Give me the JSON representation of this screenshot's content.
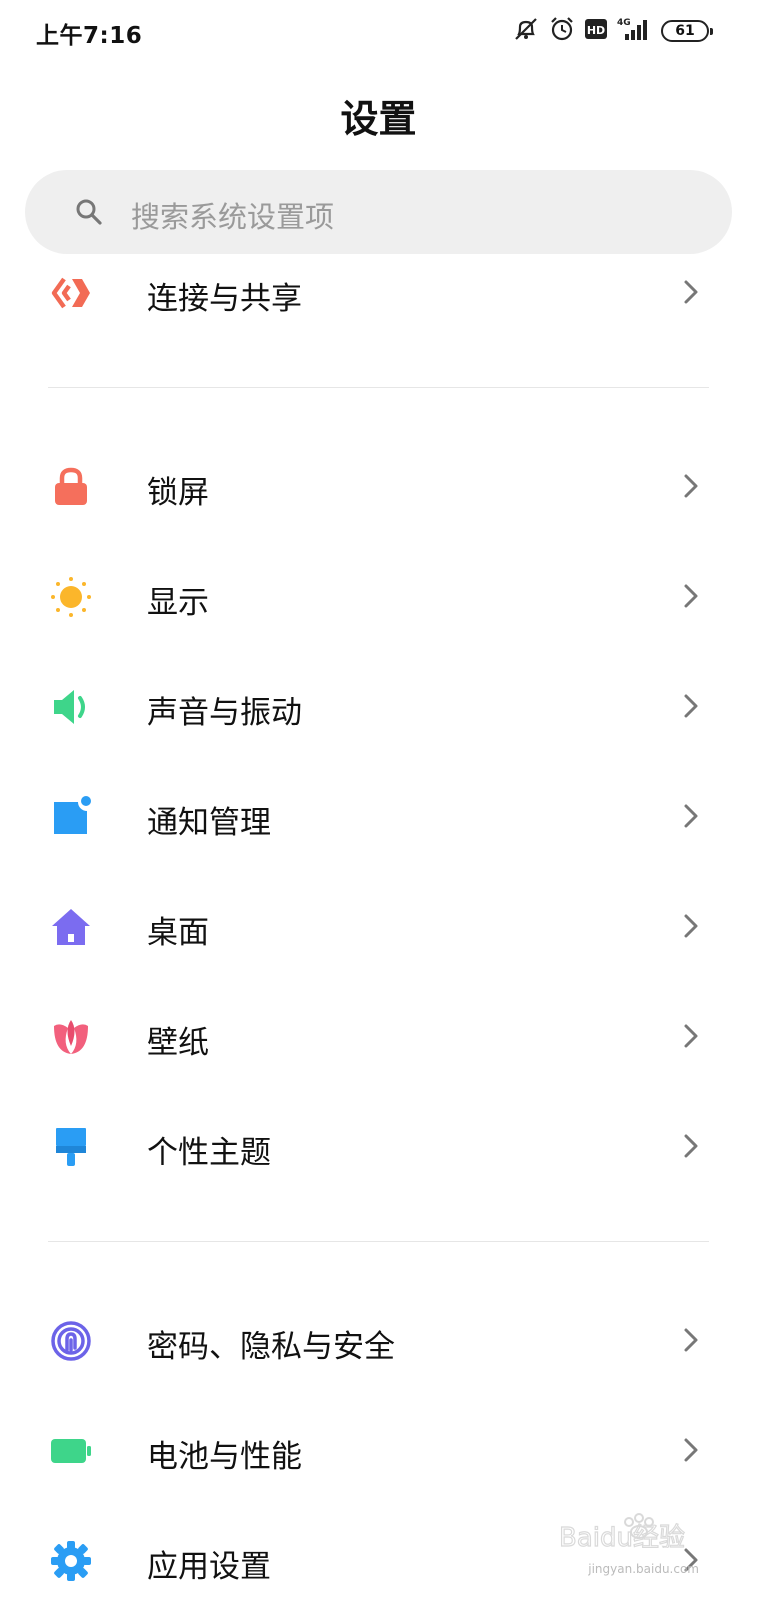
{
  "status_bar": {
    "time": "上午7:16",
    "signal_label": "4G",
    "hd_label": "HD",
    "battery": "61"
  },
  "header": {
    "title": "设置"
  },
  "search": {
    "placeholder": "搜索系统设置项"
  },
  "sections": [
    {
      "items": [
        {
          "label": "连接与共享",
          "icon": "connection-share-icon",
          "color": "#f26b55"
        }
      ]
    },
    {
      "items": [
        {
          "label": "锁屏",
          "icon": "lock-icon",
          "color": "#f56f5c"
        },
        {
          "label": "显示",
          "icon": "sun-icon",
          "color": "#fbb62b"
        },
        {
          "label": "声音与振动",
          "icon": "speaker-icon",
          "color": "#3ed58a"
        },
        {
          "label": "通知管理",
          "icon": "notification-icon",
          "color": "#2a9df4"
        },
        {
          "label": "桌面",
          "icon": "home-icon",
          "color": "#7b6cf0"
        },
        {
          "label": "壁纸",
          "icon": "tulip-icon",
          "color": "#f2607d"
        },
        {
          "label": "个性主题",
          "icon": "paint-brush-icon",
          "color": "#2a9df4"
        }
      ]
    },
    {
      "items": [
        {
          "label": "密码、隐私与安全",
          "icon": "fingerprint-icon",
          "color": "#6c63e8"
        },
        {
          "label": "电池与性能",
          "icon": "battery-icon",
          "color": "#3ed58a"
        },
        {
          "label": "应用设置",
          "icon": "gear-icon",
          "color": "#2a9df4"
        }
      ]
    }
  ],
  "watermark": {
    "text": "Baidu经验",
    "url_text": "jingyan.baidu.com"
  }
}
